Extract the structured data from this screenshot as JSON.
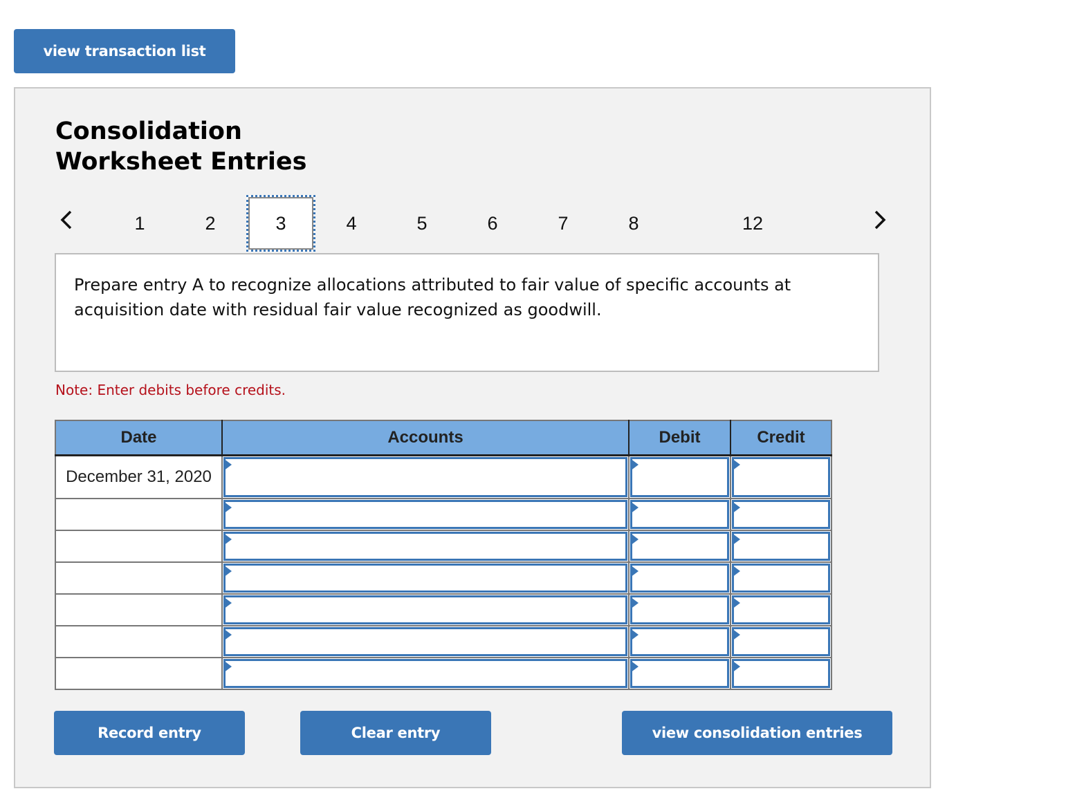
{
  "top_button": {
    "label": "view transaction list"
  },
  "panel": {
    "title_line1": "Consolidation",
    "title_line2": "Worksheet Entries",
    "pager": {
      "prev_icon": "chevron-left-icon",
      "next_icon": "chevron-right-icon",
      "pages": [
        "1",
        "2",
        "3",
        "4",
        "5",
        "6",
        "7",
        "8",
        "12"
      ],
      "active": "3"
    },
    "prompt": "Prepare entry A to recognize allocations attributed to fair value of specific accounts at acquisition date with residual fair value recognized as goodwill.",
    "note": "Note: Enter debits before credits.",
    "table": {
      "headers": {
        "date": "Date",
        "accounts": "Accounts",
        "debit": "Debit",
        "credit": "Credit"
      },
      "rows": [
        {
          "date": "December 31, 2020",
          "account": "",
          "debit": "",
          "credit": ""
        },
        {
          "date": "",
          "account": "",
          "debit": "",
          "credit": ""
        },
        {
          "date": "",
          "account": "",
          "debit": "",
          "credit": ""
        },
        {
          "date": "",
          "account": "",
          "debit": "",
          "credit": ""
        },
        {
          "date": "",
          "account": "",
          "debit": "",
          "credit": ""
        },
        {
          "date": "",
          "account": "",
          "debit": "",
          "credit": ""
        },
        {
          "date": "",
          "account": "",
          "debit": "",
          "credit": ""
        }
      ]
    },
    "buttons": {
      "record": "Record entry",
      "clear": "Clear entry",
      "view_consolidation": "view consolidation entries"
    }
  },
  "colors": {
    "accent": "#3a76b6",
    "header_bg": "#77abe0",
    "note": "#b5111b",
    "panel_bg": "#f2f2f2"
  }
}
